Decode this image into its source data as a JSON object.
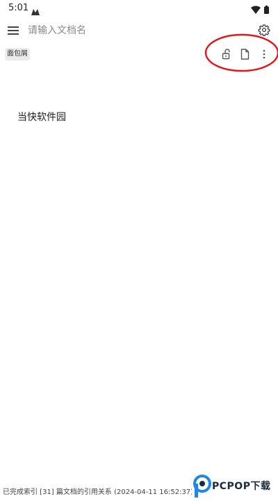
{
  "status_bar": {
    "time": "5:01"
  },
  "top_bar": {
    "doc_name_placeholder": "请输入文档名",
    "doc_name_value": ""
  },
  "toolbar": {
    "breadcrumb_label": "面包屑"
  },
  "document": {
    "content_line": "当快软件园"
  },
  "footer": {
    "index_status": "已完成索引 [31] 篇文档的引用关系 (2024-04-11 16:52:37)"
  },
  "watermark": {
    "text": "PCPOP下载"
  },
  "colors": {
    "annotation_red": "#e8141b",
    "watermark_blue": "#1e88e5",
    "icon_gray": "#555555"
  }
}
